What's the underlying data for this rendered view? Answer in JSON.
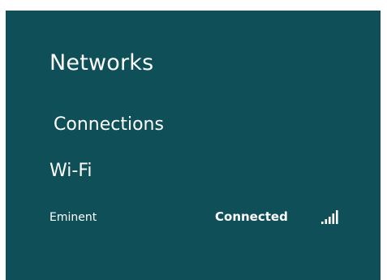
{
  "panel": {
    "title": "Networks",
    "connections_heading": "Connections",
    "wifi_heading": "Wi-Fi"
  },
  "networks": [
    {
      "name": "Eminent",
      "status": "Connected",
      "signal_icon": "wifi-signal-icon",
      "signal_bars": 5,
      "signal_max": 5
    }
  ],
  "colors": {
    "panel_background": "#0e4f58",
    "text": "#ffffff",
    "page_background": "#ffffff"
  }
}
